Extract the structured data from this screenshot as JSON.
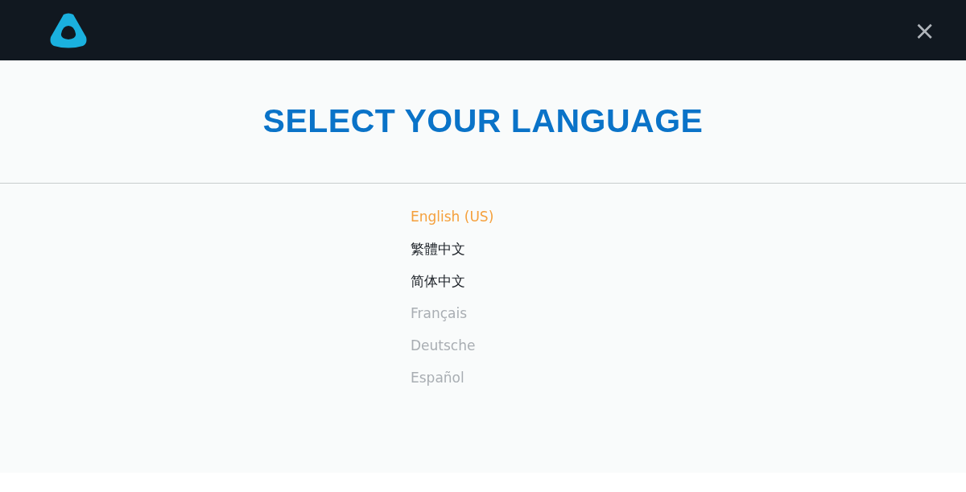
{
  "header": {
    "close": "×"
  },
  "title": "SELECT YOUR LANGUAGE",
  "languages": [
    {
      "label": "English (US)",
      "selected": true,
      "disabled": false
    },
    {
      "label": "繁體中文",
      "selected": false,
      "disabled": false
    },
    {
      "label": "简体中文",
      "selected": false,
      "disabled": false
    },
    {
      "label": "Français",
      "selected": false,
      "disabled": true
    },
    {
      "label": "Deutsche",
      "selected": false,
      "disabled": true
    },
    {
      "label": "Español",
      "selected": false,
      "disabled": true
    }
  ]
}
